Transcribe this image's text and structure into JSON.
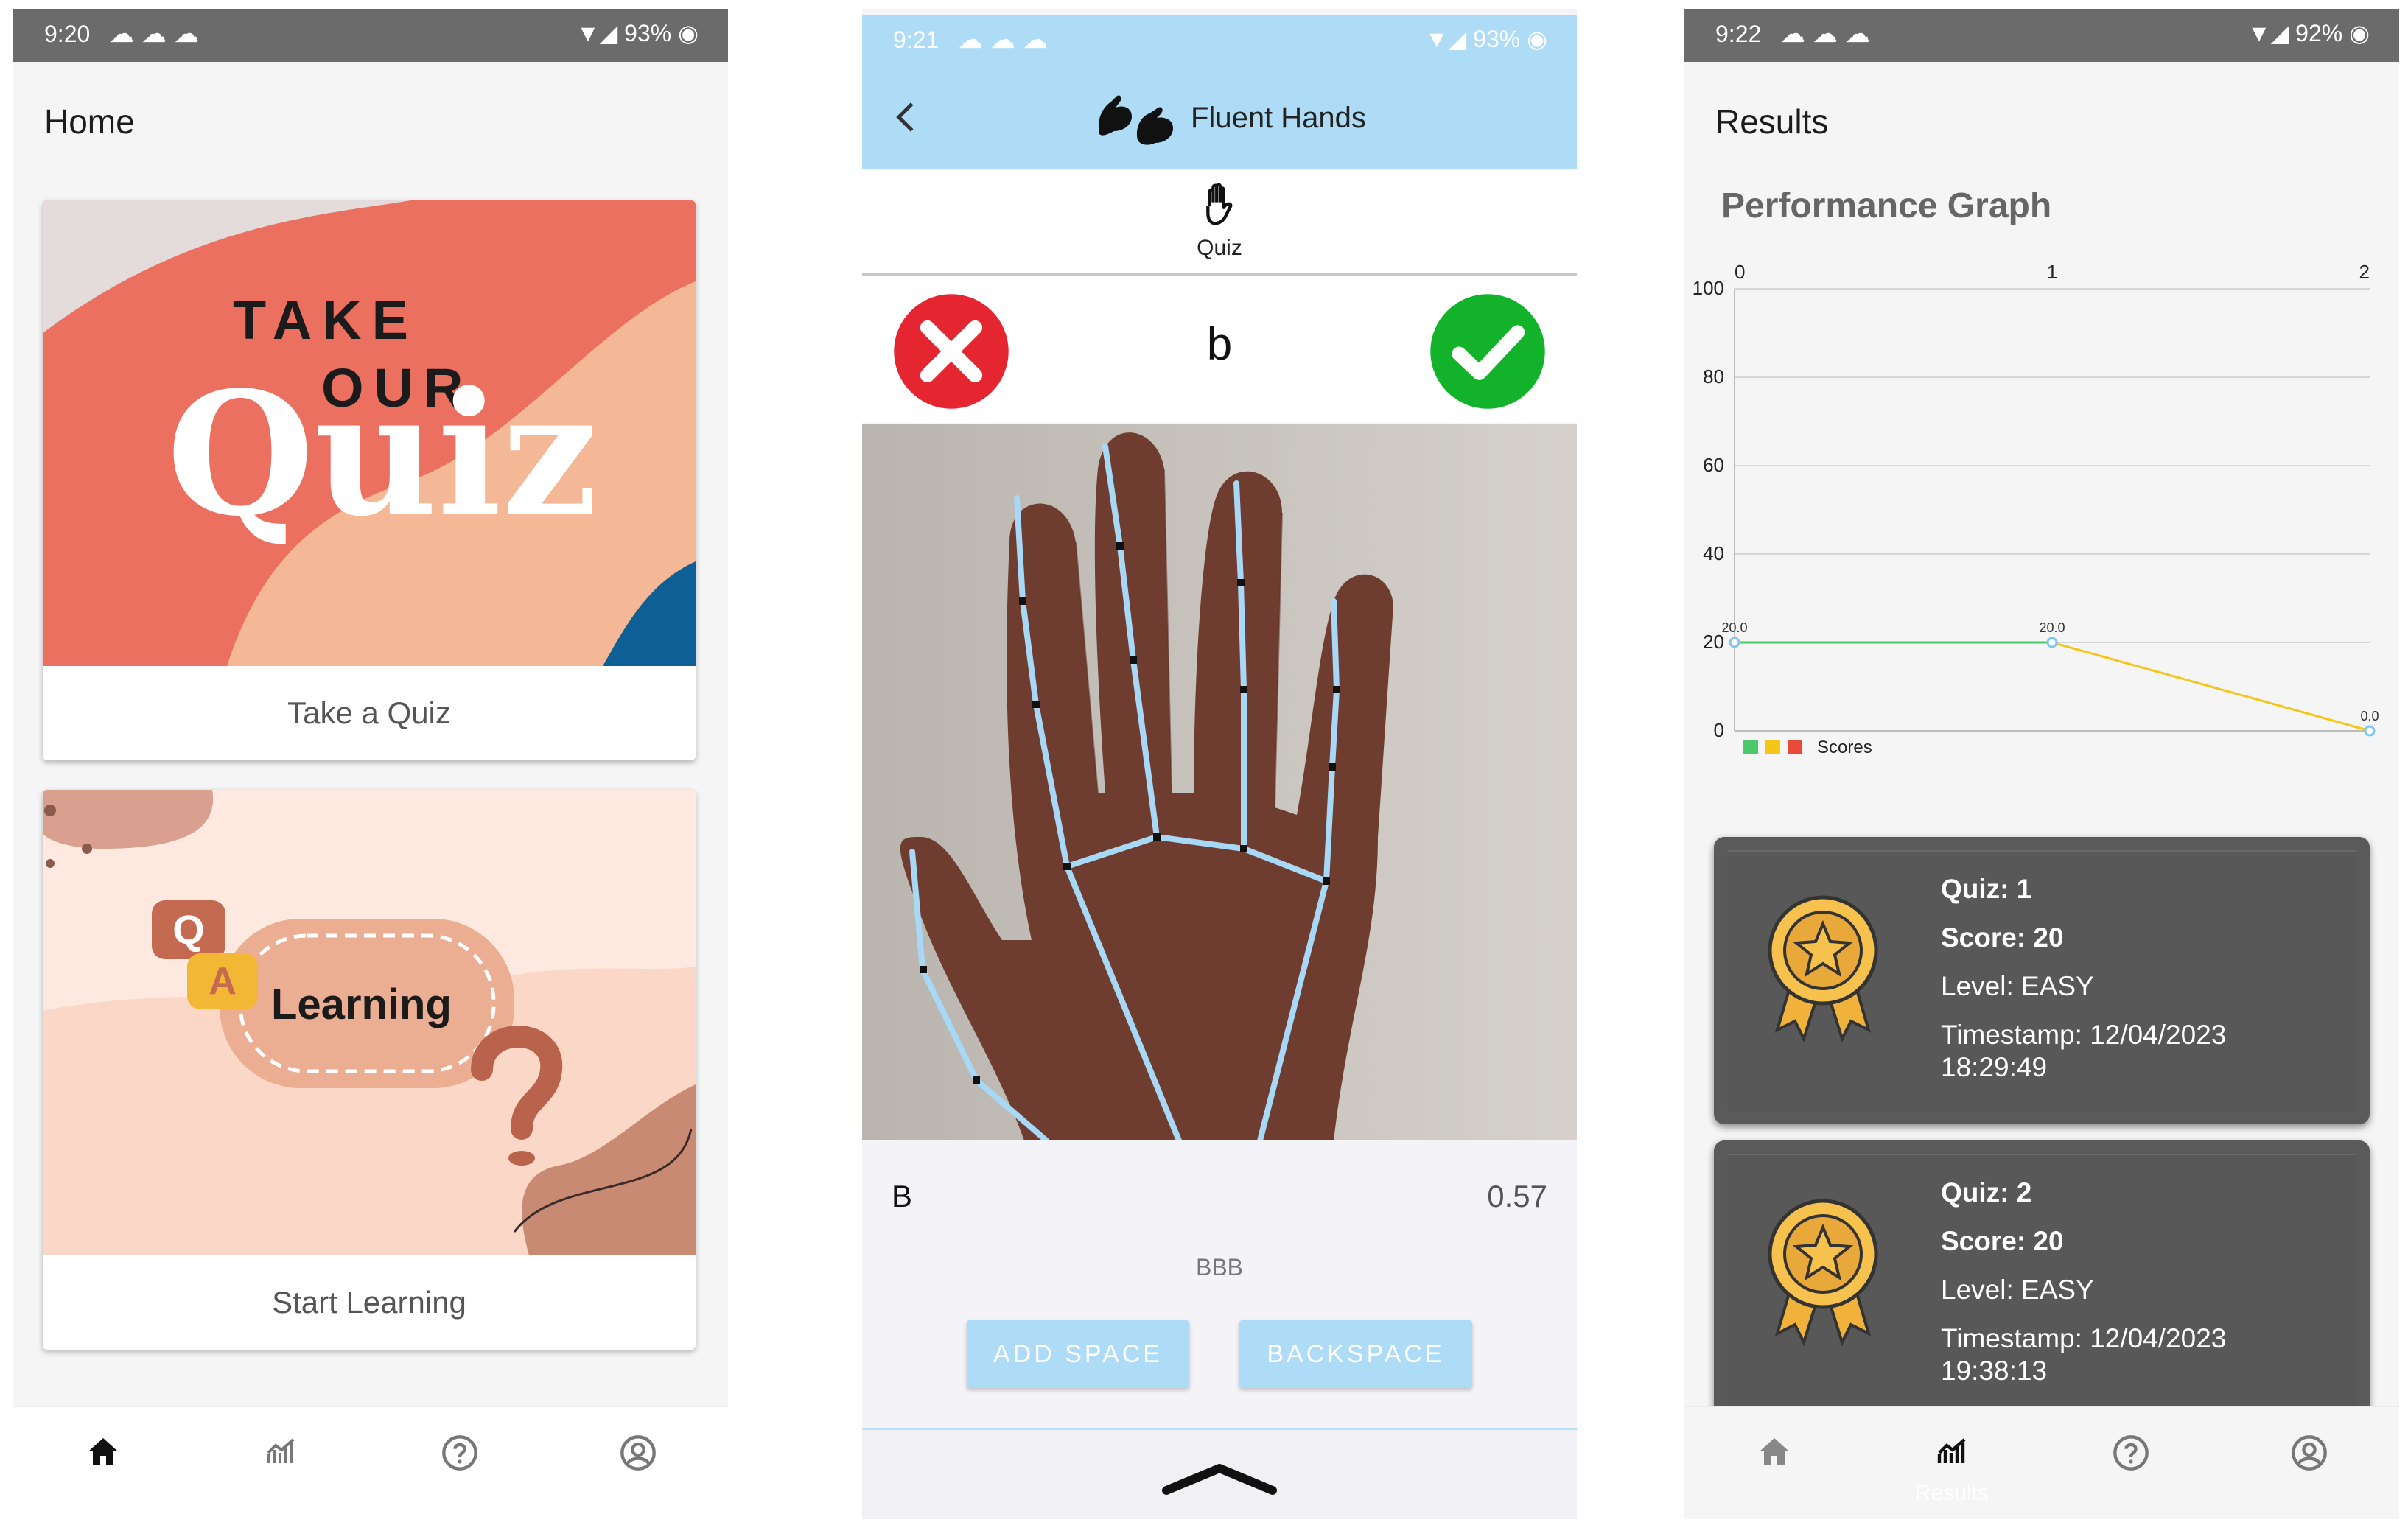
{
  "home": {
    "status": {
      "time": "9:20",
      "battery": "93%"
    },
    "title": "Home",
    "quiz_card": {
      "art_line1": "TAKE",
      "art_line2": "OUR",
      "art_line3": "Quiz",
      "label": "Take a Quiz"
    },
    "learning_card": {
      "badge_q": "Q",
      "badge_a": "A",
      "art_text": "Learning",
      "label": "Start Learning"
    },
    "nav": [
      "Home",
      "Results"
    ]
  },
  "quiz": {
    "status": {
      "time": "9:21",
      "battery": "93%"
    },
    "app_title": "Fluent Hands",
    "tab_label": "Quiz",
    "target_letter": "b",
    "detected_letter": "B",
    "confidence": "0.57",
    "sentence": "BBB",
    "add_space_label": "ADD SPACE",
    "backspace_label": "BACKSPACE"
  },
  "results": {
    "status": {
      "time": "9:22",
      "battery": "92%"
    },
    "title": "Results",
    "graph_title": "Performance Graph",
    "chart_data": {
      "type": "line",
      "x": [
        0,
        1,
        2
      ],
      "x_ticks": [
        "0",
        "1",
        "2"
      ],
      "y_ticks": [
        "0",
        "20",
        "40",
        "60",
        "80",
        "100"
      ],
      "ylim": [
        0,
        100
      ],
      "point_labels": [
        "20.0",
        "20.0",
        "0.0"
      ],
      "legend_label": "Scores",
      "legend_position": "bottom-left",
      "grid": true,
      "series": [
        {
          "name": "Scores",
          "values": [
            20,
            20,
            0
          ]
        }
      ],
      "segment_colors": [
        "#4cc96b",
        "#f5c518"
      ],
      "legend_colors": [
        "#4cc96b",
        "#f5c518",
        "#e84a3c"
      ],
      "point_color": "#7ec6f2"
    },
    "entries": [
      {
        "quiz": "Quiz: 1",
        "score": "Score: 20",
        "level": "Level: EASY",
        "timestamp": "Timestamp: 12/04/2023",
        "time": "18:29:49"
      },
      {
        "quiz": "Quiz: 2",
        "score": "Score: 20",
        "level": "Level: EASY",
        "timestamp": "Timestamp: 12/04/2023",
        "time": "19:38:13"
      }
    ],
    "nav": [
      "Home",
      "Results"
    ]
  },
  "colors": {
    "status_bar": "#6b6b6b",
    "quiz_app_bar": "#aedcf7",
    "button": "#aedcf7",
    "wrong": "#e52630",
    "correct": "#12b32a",
    "result_card": "#5a5a5a"
  },
  "icons": [
    "home-icon",
    "chart-icon",
    "help-icon",
    "account-icon",
    "back-arrow-icon",
    "sign-language-logo-icon",
    "hand-icon",
    "wrong-icon",
    "correct-icon",
    "medal-icon",
    "expand-up-icon"
  ]
}
